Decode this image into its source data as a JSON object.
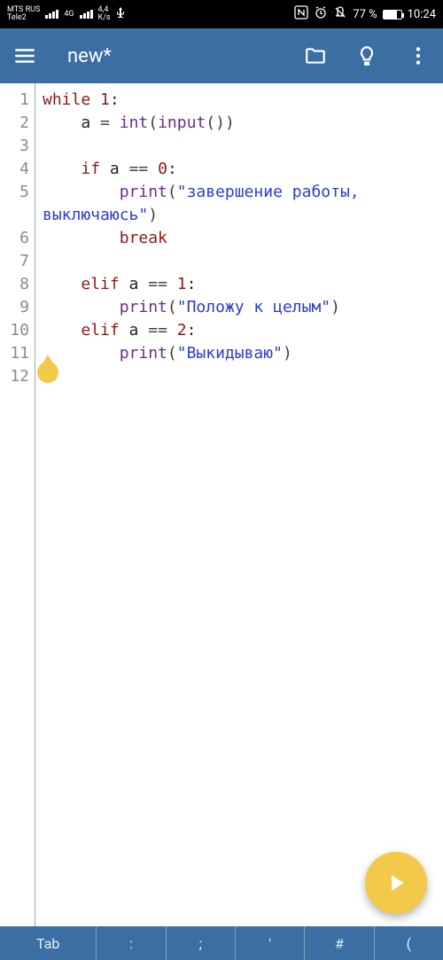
{
  "status": {
    "carrier1": "MTS RUS",
    "carrier2": "Tele2",
    "net_tag": "4G",
    "speed": "4,4",
    "speed_unit": "K/s",
    "battery_pct": "77 %",
    "time": "10:24"
  },
  "appbar": {
    "title": "new*"
  },
  "code": {
    "lines": [
      {
        "n": "1",
        "tokens": [
          [
            "kw",
            "while"
          ],
          [
            "",
            " "
          ],
          [
            "num",
            "1"
          ],
          [
            "",
            ":"
          ]
        ]
      },
      {
        "n": "2",
        "tokens": [
          [
            "",
            "    a "
          ],
          [
            "op",
            "="
          ],
          [
            "",
            " "
          ],
          [
            "fn",
            "int"
          ],
          [
            "paren",
            "("
          ],
          [
            "fn",
            "input"
          ],
          [
            "paren",
            "("
          ],
          [
            "paren",
            ")"
          ],
          [
            "paren",
            ")"
          ]
        ]
      },
      {
        "n": "3",
        "tokens": []
      },
      {
        "n": "4",
        "tokens": [
          [
            "",
            "    "
          ],
          [
            "kw",
            "if"
          ],
          [
            "",
            " a "
          ],
          [
            "op",
            "=="
          ],
          [
            "",
            " "
          ],
          [
            "num",
            "0"
          ],
          [
            "",
            ":"
          ]
        ]
      },
      {
        "n": "5",
        "tokens": [
          [
            "",
            "        "
          ],
          [
            "fn",
            "print"
          ],
          [
            "paren",
            "("
          ],
          [
            "str",
            "\"завершение работы, выключаюсь\""
          ],
          [
            "paren",
            ")"
          ]
        ],
        "wrapped": true
      },
      {
        "n": "6",
        "tokens": [
          [
            "",
            "        "
          ],
          [
            "kw",
            "break"
          ]
        ]
      },
      {
        "n": "7",
        "tokens": []
      },
      {
        "n": "8",
        "tokens": [
          [
            "",
            "    "
          ],
          [
            "kw",
            "elif"
          ],
          [
            "",
            " a "
          ],
          [
            "op",
            "=="
          ],
          [
            "",
            " "
          ],
          [
            "num",
            "1"
          ],
          [
            "",
            ":"
          ]
        ]
      },
      {
        "n": "9",
        "tokens": [
          [
            "",
            "        "
          ],
          [
            "fn",
            "print"
          ],
          [
            "paren",
            "("
          ],
          [
            "str",
            "\"Положу к целым\""
          ],
          [
            "paren",
            ")"
          ]
        ]
      },
      {
        "n": "10",
        "tokens": [
          [
            "",
            "    "
          ],
          [
            "kw",
            "elif"
          ],
          [
            "",
            " a "
          ],
          [
            "op",
            "=="
          ],
          [
            "",
            " "
          ],
          [
            "num",
            "2"
          ],
          [
            "",
            ":"
          ]
        ]
      },
      {
        "n": "11",
        "tokens": [
          [
            "",
            "        "
          ],
          [
            "fn",
            "print"
          ],
          [
            "paren",
            "("
          ],
          [
            "str",
            "\"Выкидываю\""
          ],
          [
            "paren",
            ")"
          ]
        ]
      },
      {
        "n": "12",
        "tokens": []
      }
    ]
  },
  "bottombar": {
    "tab": "Tab",
    "k1": ":",
    "k2": ";",
    "k3": "'",
    "k4": "#",
    "k5": "("
  }
}
